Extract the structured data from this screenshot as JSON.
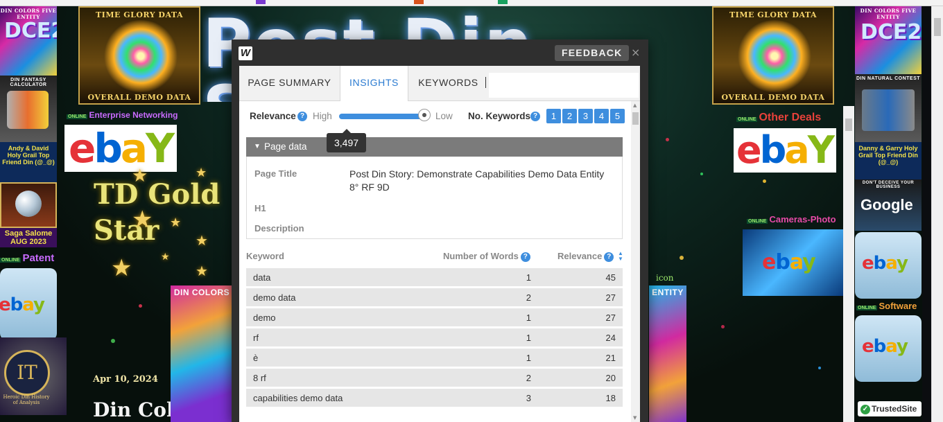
{
  "page": {
    "banner_title": "Post Din Story",
    "left_tiles": {
      "din_colors_caption": "DIN COLORS FIVE ENTITY",
      "fantasy_caption": "DIN FANTASY CALCULATOR",
      "andy_caption": "Andy & David Holy Grail Top Friend Din (@_@)",
      "saga_caption": "Saga Salome AUG 2023",
      "patent_label": "Patent",
      "it_caption": "IT",
      "it_subcaption": "Heroic Din History of Analysis"
    },
    "gold_tiles": {
      "top_caption": "TIME GLORY DATA",
      "bottom_caption": "OVERALL DEMO DATA"
    },
    "enterprise_label": "Enterprise Networking",
    "td_gold_star": "TD Gold Star",
    "blog_date": "Apr 10, 2024",
    "blog_heading": "Din Col",
    "right_tiles": {
      "din_colors_caption": "DIN COLORS FIVE ENTITY",
      "natural_caption": "DIN NATURAL CONTEST",
      "danny_caption": "Danny & Garry Holy Grail Top Friend Din (@_@)",
      "google_caption": "DON'T DECEIVE YOUR BUSINESS",
      "google_word": "Google",
      "software_label": "Software",
      "trusted": "TrustedSite"
    },
    "other_deals": "Other Deals",
    "cameras_photo": "Cameras-Photo",
    "online_tag": "ONLINE",
    "icon_alt": "icon",
    "ebay_word": {
      "e": "e",
      "b": "b",
      "a": "a",
      "y": "Y"
    },
    "ebay_word_small": "ebay",
    "mid_tile_caption": "DIN COLORS",
    "mid_tile_caption_right": "ENTITY"
  },
  "panel": {
    "logo": "W",
    "feedback_label": "FEEDBACK",
    "close_label": "×",
    "tabs": [
      {
        "label": "PAGE SUMMARY"
      },
      {
        "label": "INSIGHTS"
      },
      {
        "label": "KEYWORDS"
      }
    ],
    "relevance": {
      "label": "Relevance",
      "high": "High",
      "low": "Low",
      "slider_level": 1.0,
      "tooltip": "3,497",
      "keywords_label": "No. Keywords",
      "keyword_counts": [
        "1",
        "2",
        "3",
        "4",
        "5"
      ]
    },
    "help_glyph": "?",
    "page_data": {
      "header": "Page data",
      "fields": [
        {
          "key": "Page Title",
          "value": "Post Din Story: Demonstrate Capabilities Demo Data Entity 8° RF 9D"
        },
        {
          "key": "H1",
          "value": ""
        },
        {
          "key": "Description",
          "value": ""
        }
      ]
    },
    "keyword_table": {
      "columns": [
        "Keyword",
        "Number of Words",
        "Relevance"
      ],
      "rows": [
        {
          "keyword": "data",
          "words": "1",
          "relevance": "45"
        },
        {
          "keyword": "demo data",
          "words": "2",
          "relevance": "27"
        },
        {
          "keyword": "demo",
          "words": "1",
          "relevance": "27"
        },
        {
          "keyword": "rf",
          "words": "1",
          "relevance": "24"
        },
        {
          "keyword": "è",
          "words": "1",
          "relevance": "21"
        },
        {
          "keyword": "8 rf",
          "words": "2",
          "relevance": "20"
        },
        {
          "keyword": "capabilities demo data",
          "words": "3",
          "relevance": "18"
        }
      ]
    }
  }
}
